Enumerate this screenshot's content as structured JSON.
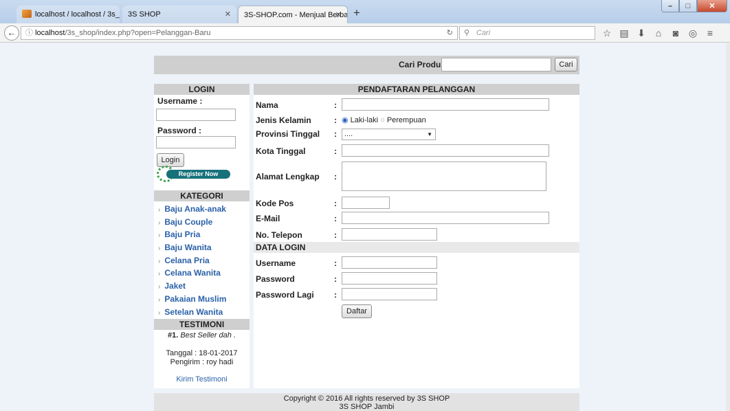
{
  "browser": {
    "tabs": [
      {
        "label": "localhost / localhost / 3s_s..."
      },
      {
        "label": "3S SHOP"
      },
      {
        "label": "3S-SHOP.com - Menjual Berba..."
      }
    ],
    "url_host": "localhost",
    "url_path": "/3s_shop/index.php?open=Pelanggan-Baru",
    "search_placeholder": "Cari",
    "icons": [
      "star-icon",
      "bookmarks-list-icon",
      "download-icon",
      "home-icon",
      "pocket-icon",
      "addon-icon",
      "menu-icon"
    ]
  },
  "search": {
    "label": "Cari Produk",
    "button": "Cari"
  },
  "login": {
    "title": "LOGIN",
    "username_label": "Username :",
    "password_label": "Password :",
    "button": "Login",
    "register_badge": "Register Now"
  },
  "kategori": {
    "title": "KATEGORI",
    "items": [
      "Baju Anak-anak",
      "Baju Couple",
      "Baju Pria",
      "Baju Wanita",
      "Celana Pria",
      "Celana Wanita",
      "Jaket",
      "Pakaian Muslim",
      "Setelan Wanita"
    ]
  },
  "testimoni": {
    "title": "TESTIMONI",
    "number": "#1.",
    "text": "Best Seller dah .",
    "date": "Tanggal : 18-01-2017",
    "sender": "Pengirim : roy hadi",
    "link": "Kirim Testimoni"
  },
  "form": {
    "title": "PENDAFTARAN PELANGGAN",
    "nama": "Nama",
    "jenis_kelamin": "Jenis Kelamin",
    "gender_male": "Laki-laki",
    "gender_female": "Perempuan",
    "provinsi": "Provinsi Tinggal",
    "provinsi_value": "....",
    "kota": "Kota Tinggal",
    "alamat": "Alamat Lengkap",
    "kode_pos": "Kode Pos",
    "email": "E-Mail",
    "telepon": "No. Telepon",
    "data_login": "DATA LOGIN",
    "username": "Username",
    "password": "Password",
    "password_lagi": "Password Lagi",
    "button": "Daftar",
    "colon": ":"
  },
  "footer": {
    "line1": "Copyright © 2016 All rights reserved by 3S SHOP",
    "line2": "3S SHOP Jambi"
  }
}
